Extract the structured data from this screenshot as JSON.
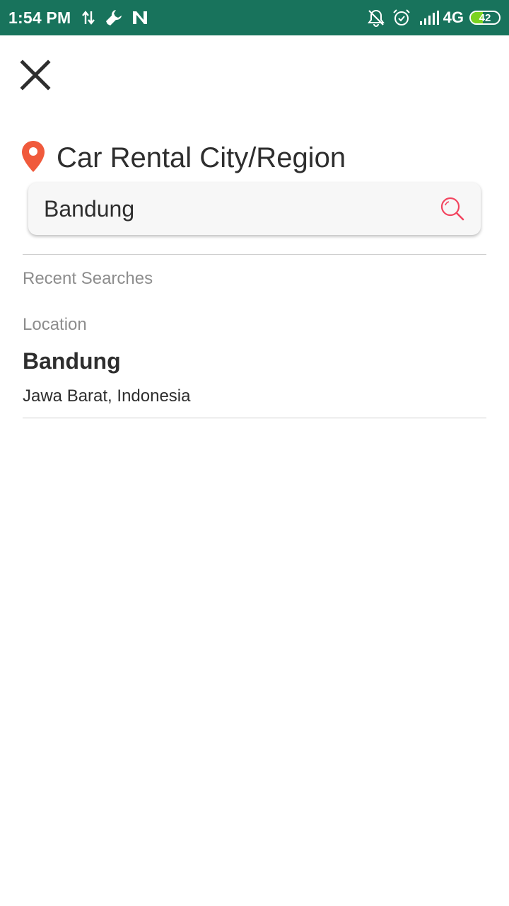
{
  "status_bar": {
    "time": "1:54 PM",
    "left_icons": [
      "data-transfer-icon",
      "wrench-icon",
      "n-app-icon"
    ],
    "right_icons": [
      "notifications-off-icon",
      "alarm-icon",
      "signal-icon"
    ],
    "network": "4G",
    "battery": "42",
    "battery_level_percent": 42,
    "background_color": "#18735c"
  },
  "header": {
    "close_icon": "close-icon"
  },
  "title": {
    "icon": "location-pin-icon",
    "icon_color": "#f05a3c",
    "text": "Car Rental City/Region"
  },
  "search": {
    "value": "Bandung",
    "icon": "search-icon",
    "icon_color": "#f2455f"
  },
  "recent": {
    "label": "Recent Searches"
  },
  "location_section": {
    "label": "Location",
    "items": [
      {
        "name": "Bandung",
        "subtitle": "Jawa Barat, Indonesia"
      }
    ]
  }
}
